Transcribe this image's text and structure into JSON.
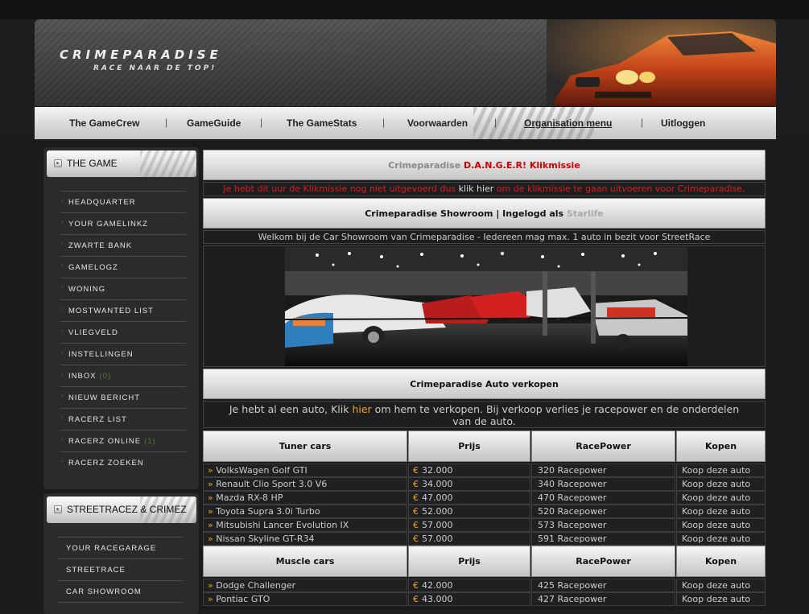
{
  "header": {
    "logo": "CRIMEPARADISE",
    "slogan": "RACE NAAR DE TOP!"
  },
  "nav": [
    "The GameCrew",
    "GameGuide",
    "The GameStats",
    "Voorwaarden",
    "Organisation menu",
    "Uitloggen"
  ],
  "sidebar": {
    "game": {
      "title": "THE GAME",
      "items": [
        {
          "label": "HEADQUARTER"
        },
        {
          "label": "YOUR GAMELINKZ"
        },
        {
          "label": "ZWARTE BANK"
        },
        {
          "label": "GAMELOGZ"
        },
        {
          "label": "WONING"
        },
        {
          "label": "MOSTWANTED LIST"
        },
        {
          "label": "VLIEGVELD"
        },
        {
          "label": "INSTELLINGEN"
        },
        {
          "label": "INBOX",
          "count": "(0)"
        },
        {
          "label": "NIEUW BERICHT"
        },
        {
          "label": "RACERZ LIST"
        },
        {
          "label": "RACERZ ONLINE",
          "count": "(1)"
        },
        {
          "label": "RACERZ ZOEKEN"
        }
      ]
    },
    "streetrace": {
      "title": "STREETRACEZ & CRIMEZ",
      "items": [
        {
          "label": "YOUR RACEGARAGE"
        },
        {
          "label": "STREETRACE"
        },
        {
          "label": "CAR SHOWROOM"
        }
      ]
    }
  },
  "klikmissie": {
    "title_prefix": "Crimeparadise",
    "title_main": "D.A.N.G.E.R! Klikmissie",
    "msg_before": "Je hebt dit uur de Klikmissie nog niet uitgevoerd dus",
    "msg_link": "klik hier",
    "msg_after": "om de klikmissie te gaan uitvoeren voor Crimeparadise."
  },
  "showroom": {
    "title": "Crimeparadise Showroom | Ingelogd als",
    "user": "Starlife",
    "welcome": "Welkom bij de Car Showroom van Crimeparadise - Iedereen mag max. 1 auto in bezit voor StreetRace"
  },
  "sell": {
    "title": "Crimeparadise Auto verkopen",
    "msg_before": "Je hebt al een auto, Klik",
    "msg_link": "hier",
    "msg_after": "om hem te verkopen. Bij verkoop verlies je racepower en de onderdelen",
    "msg_line2": "van de auto."
  },
  "tuner": {
    "headers": [
      "Tuner cars",
      "Prijs",
      "RacePower",
      "Kopen"
    ],
    "rows": [
      {
        "name": "VolksWagen Golf GTI",
        "price": "32.000",
        "power": "320 Racepower",
        "buy": "Koop deze auto"
      },
      {
        "name": "Renault Clio Sport 3.0 V6",
        "price": "34.000",
        "power": "340 Racepower",
        "buy": "Koop deze auto"
      },
      {
        "name": "Mazda RX-8 HP",
        "price": "47.000",
        "power": "470 Racepower",
        "buy": "Koop deze auto"
      },
      {
        "name": "Toyota Supra 3.0i Turbo",
        "price": "52.000",
        "power": "520 Racepower",
        "buy": "Koop deze auto"
      },
      {
        "name": "Mitsubishi Lancer Evolution IX",
        "price": "57.000",
        "power": "573 Racepower",
        "buy": "Koop deze auto"
      },
      {
        "name": "Nissan Skyline GT-R34",
        "price": "57.000",
        "power": "591 Racepower",
        "buy": "Koop deze auto"
      }
    ]
  },
  "muscle": {
    "headers": [
      "Muscle cars",
      "Prijs",
      "RacePower",
      "Kopen"
    ],
    "rows": [
      {
        "name": "Dodge Challenger",
        "price": "42.000",
        "power": "425 Racepower",
        "buy": "Koop deze auto"
      },
      {
        "name": "Pontiac GTO",
        "price": "43.000",
        "power": "427 Racepower",
        "buy": "Koop deze auto"
      }
    ]
  },
  "symbols": {
    "arrow": "»",
    "euro": "€",
    "bullet": "›"
  },
  "colors": {
    "accent_orange": "#f0a020",
    "alert_red": "#e01b1b",
    "count_green": "#5c7a2a"
  }
}
